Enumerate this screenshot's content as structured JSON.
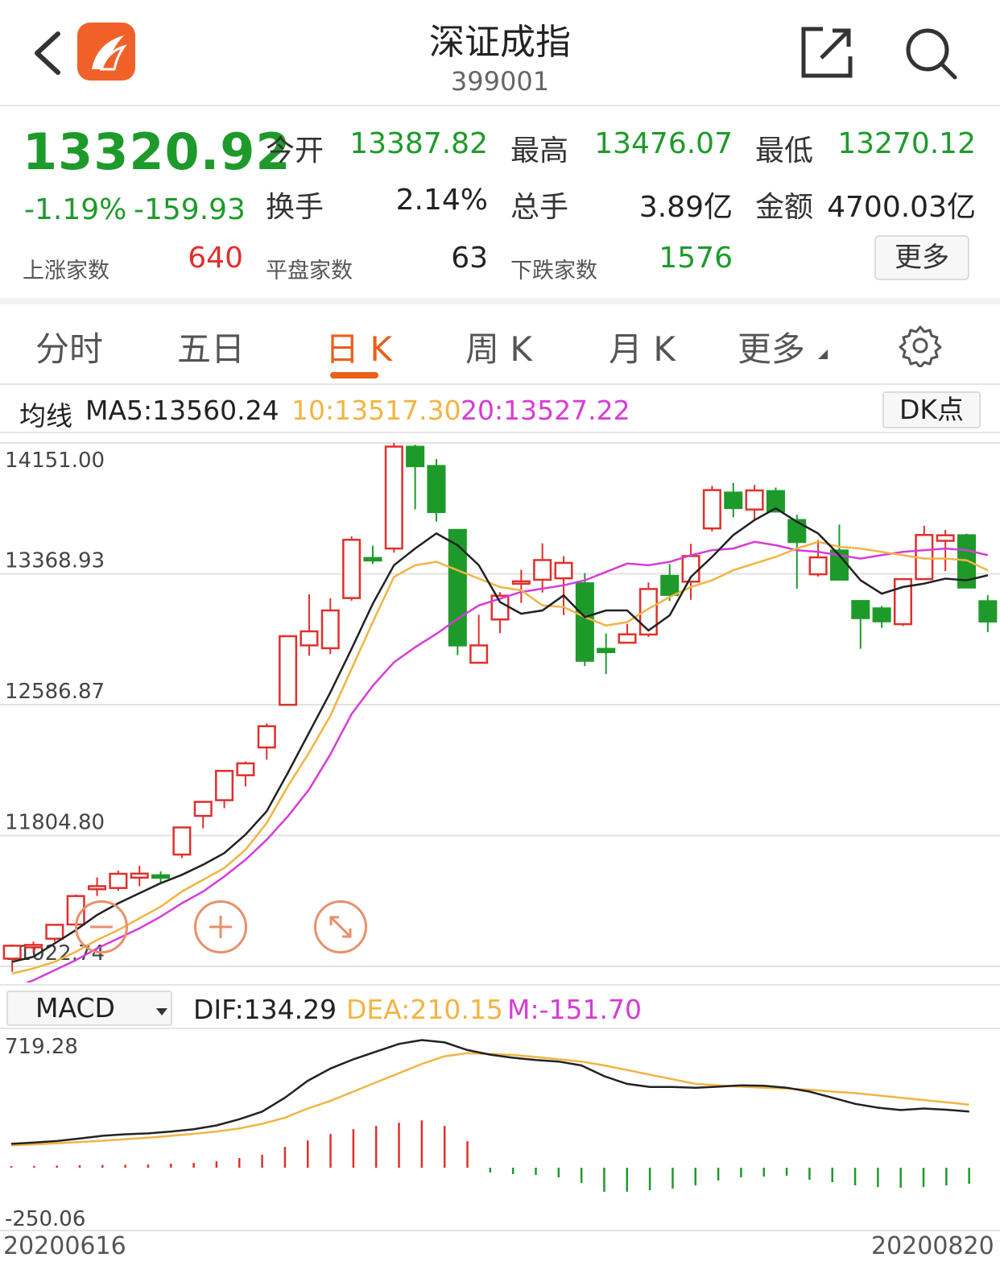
{
  "header": {
    "title": "深证成指",
    "code": "399001"
  },
  "quote": {
    "price": "13320.92",
    "change_pct": "-1.19%",
    "change": "-159.93",
    "open_label": "今开",
    "open": "13387.82",
    "high_label": "最高",
    "high": "13476.07",
    "low_label": "最低",
    "low": "13270.12",
    "turnover_label": "换手",
    "turnover": "2.14%",
    "volume_label": "总手",
    "volume": "3.89亿",
    "amount_label": "金额",
    "amount": "4700.03亿",
    "up_label": "上涨家数",
    "up_count": "640",
    "flat_label": "平盘家数",
    "flat_count": "63",
    "down_label": "下跌家数",
    "down_count": "1576",
    "more": "更多"
  },
  "tabs": [
    {
      "label": "分时"
    },
    {
      "label": "五日"
    },
    {
      "label": "日 K",
      "active": true
    },
    {
      "label": "周 K"
    },
    {
      "label": "月 K"
    },
    {
      "label": "更多"
    }
  ],
  "ma": {
    "label": "均线",
    "ma5": "MA5:13560.24",
    "ma10": "10:13517.30",
    "ma20": "20:13527.22",
    "dk": "DK点"
  },
  "colors": {
    "up": "#e0302c",
    "down": "#1e9a2b",
    "ma5": "#222222",
    "ma10": "#f2b443",
    "ma20": "#d63cd6",
    "accent": "#e8601c"
  },
  "macd": {
    "indicator": "MACD",
    "dif": "DIF:134.29",
    "dea": "DEA:210.15",
    "m": "M:-151.70"
  },
  "dates": {
    "start": "20200616",
    "end": "20200820"
  },
  "chart_data": [
    {
      "type": "candlestick",
      "yticks": [
        "14151.00",
        "13368.93",
        "12586.87",
        "11804.80",
        "11022.74"
      ],
      "ylim": [
        11022.74,
        14151.0
      ],
      "candles": [
        {
          "o": 11069,
          "h": 11151,
          "l": 10990,
          "c": 11146
        },
        {
          "o": 11151,
          "h": 11171,
          "l": 11106,
          "c": 11151
        },
        {
          "o": 11188,
          "h": 11270,
          "l": 11170,
          "c": 11271
        },
        {
          "o": 11273,
          "h": 11452,
          "l": 11260,
          "c": 11443
        },
        {
          "o": 11484,
          "h": 11554,
          "l": 11443,
          "c": 11502
        },
        {
          "o": 11491,
          "h": 11595,
          "l": 11475,
          "c": 11576
        },
        {
          "o": 11553,
          "h": 11624,
          "l": 11502,
          "c": 11577
        },
        {
          "o": 11567,
          "h": 11590,
          "l": 11518,
          "c": 11553
        },
        {
          "o": 11691,
          "h": 11852,
          "l": 11670,
          "c": 11853
        },
        {
          "o": 11922,
          "h": 12006,
          "l": 11848,
          "c": 12006
        },
        {
          "o": 12016,
          "h": 12194,
          "l": 11968,
          "c": 12191
        },
        {
          "o": 12165,
          "h": 12247,
          "l": 12098,
          "c": 12236
        },
        {
          "o": 12331,
          "h": 12474,
          "l": 12258,
          "c": 12458
        },
        {
          "o": 12586,
          "h": 12996,
          "l": 12584,
          "c": 12996
        },
        {
          "o": 12941,
          "h": 13246,
          "l": 12880,
          "c": 13025
        },
        {
          "o": 12924,
          "h": 13223,
          "l": 12889,
          "c": 13150
        },
        {
          "o": 13224,
          "h": 13592,
          "l": 13208,
          "c": 13572
        },
        {
          "o": 13463,
          "h": 13537,
          "l": 13427,
          "c": 13452
        },
        {
          "o": 13520,
          "h": 14151,
          "l": 13495,
          "c": 14129
        },
        {
          "o": 14128,
          "h": 14140,
          "l": 13754,
          "c": 14012
        },
        {
          "o": 14013,
          "h": 14054,
          "l": 13681,
          "c": 13738
        },
        {
          "o": 13631,
          "h": 13631,
          "l": 12882,
          "c": 12941
        },
        {
          "o": 12837,
          "h": 13124,
          "l": 12876,
          "c": 12941
        },
        {
          "o": 13096,
          "h": 13259,
          "l": 13014,
          "c": 13238
        },
        {
          "o": 13312,
          "h": 13393,
          "l": 13195,
          "c": 13324
        },
        {
          "o": 13333,
          "h": 13551,
          "l": 13257,
          "c": 13451
        },
        {
          "o": 13342,
          "h": 13474,
          "l": 13122,
          "c": 13434
        },
        {
          "o": 13312,
          "h": 13373,
          "l": 12817,
          "c": 12849
        },
        {
          "o": 12920,
          "h": 13012,
          "l": 12770,
          "c": 12901
        },
        {
          "o": 12957,
          "h": 13069,
          "l": 12953,
          "c": 13007
        },
        {
          "o": 13006,
          "h": 13317,
          "l": 12992,
          "c": 13278
        },
        {
          "o": 13356,
          "h": 13427,
          "l": 13206,
          "c": 13243
        },
        {
          "o": 13322,
          "h": 13548,
          "l": 13213,
          "c": 13475
        },
        {
          "o": 13640,
          "h": 13895,
          "l": 13622,
          "c": 13869
        },
        {
          "o": 13854,
          "h": 13912,
          "l": 13706,
          "c": 13762
        },
        {
          "o": 13753,
          "h": 13900,
          "l": 13691,
          "c": 13867
        },
        {
          "o": 13863,
          "h": 13884,
          "l": 13743,
          "c": 13741
        },
        {
          "o": 13690,
          "h": 13722,
          "l": 13280,
          "c": 13559
        },
        {
          "o": 13366,
          "h": 13571,
          "l": 13352,
          "c": 13467
        },
        {
          "o": 13508,
          "h": 13663,
          "l": 13370,
          "c": 13334
        },
        {
          "o": 13206,
          "h": 13200,
          "l": 12921,
          "c": 13104
        },
        {
          "o": 13162,
          "h": 13177,
          "l": 13046,
          "c": 13085
        },
        {
          "o": 13068,
          "h": 13339,
          "l": 13056,
          "c": 13337
        },
        {
          "o": 13337,
          "h": 13656,
          "l": 13367,
          "c": 13601
        },
        {
          "o": 13566,
          "h": 13631,
          "l": 13385,
          "c": 13599
        },
        {
          "o": 13599,
          "h": 13609,
          "l": 13320,
          "c": 13287
        },
        {
          "o": 13205,
          "h": 13241,
          "l": 13020,
          "c": 13084
        }
      ],
      "ma5": [
        11050,
        11080,
        11160,
        11240,
        11330,
        11400,
        11460,
        11520,
        11570,
        11630,
        11700,
        11810,
        11950,
        12180,
        12420,
        12660,
        12920,
        13190,
        13420,
        13520,
        13610,
        13540,
        13420,
        13200,
        13130,
        13150,
        13240,
        13110,
        13150,
        13150,
        13030,
        13120,
        13350,
        13470,
        13600,
        13690,
        13760,
        13680,
        13610,
        13480,
        13330,
        13250,
        13290,
        13310,
        13340,
        13330,
        13360
      ],
      "ma10": [
        10980,
        11010,
        11050,
        11110,
        11180,
        11240,
        11310,
        11380,
        11470,
        11540,
        11610,
        11720,
        11880,
        12100,
        12300,
        12520,
        12800,
        13080,
        13350,
        13420,
        13440,
        13390,
        13340,
        13290,
        13270,
        13180,
        13170,
        13110,
        13060,
        13080,
        13160,
        13230,
        13290,
        13330,
        13390,
        13430,
        13470,
        13520,
        13560,
        13530,
        13520,
        13500,
        13480,
        13460,
        13460,
        13450,
        13390
      ],
      "ma20": [
        10890,
        10940,
        11000,
        11060,
        11130,
        11190,
        11250,
        11320,
        11400,
        11470,
        11560,
        11660,
        11780,
        11920,
        12080,
        12290,
        12530,
        12700,
        12840,
        12930,
        13010,
        13100,
        13180,
        13220,
        13260,
        13280,
        13300,
        13330,
        13380,
        13430,
        13420,
        13440,
        13480,
        13510,
        13520,
        13560,
        13540,
        13510,
        13500,
        13480,
        13460,
        13480,
        13500,
        13510,
        13520,
        13510,
        13480
      ]
    },
    {
      "type": "macd",
      "yticks": [
        "719.28",
        "-250.06"
      ],
      "ylim": [
        -250.06,
        719.28
      ],
      "dif": [
        40,
        48,
        58,
        75,
        92,
        102,
        108,
        120,
        135,
        160,
        200,
        250,
        340,
        450,
        530,
        590,
        640,
        690,
        715,
        700,
        650,
        620,
        600,
        585,
        575,
        550,
        480,
        430,
        410,
        410,
        405,
        412,
        420,
        418,
        405,
        380,
        340,
        300,
        275,
        260,
        270,
        262,
        250
      ],
      "dea": [
        30,
        36,
        44,
        52,
        60,
        70,
        80,
        92,
        105,
        120,
        140,
        170,
        210,
        270,
        320,
        380,
        440,
        500,
        560,
        610,
        630,
        625,
        618,
        605,
        590,
        575,
        550,
        520,
        490,
        460,
        430,
        420,
        412,
        405,
        400,
        392,
        380,
        370,
        355,
        340,
        325,
        310,
        295
      ],
      "hist": [
        20,
        22,
        26,
        30,
        34,
        36,
        40,
        50,
        60,
        80,
        120,
        160,
        260,
        340,
        420,
        480,
        520,
        560,
        590,
        520,
        330,
        -60,
        -80,
        -90,
        -120,
        -190,
        -300,
        -300,
        -280,
        -260,
        -220,
        -160,
        -120,
        -110,
        -100,
        -150,
        -180,
        -220,
        -240,
        -250,
        -240,
        -220,
        -200
      ]
    }
  ]
}
